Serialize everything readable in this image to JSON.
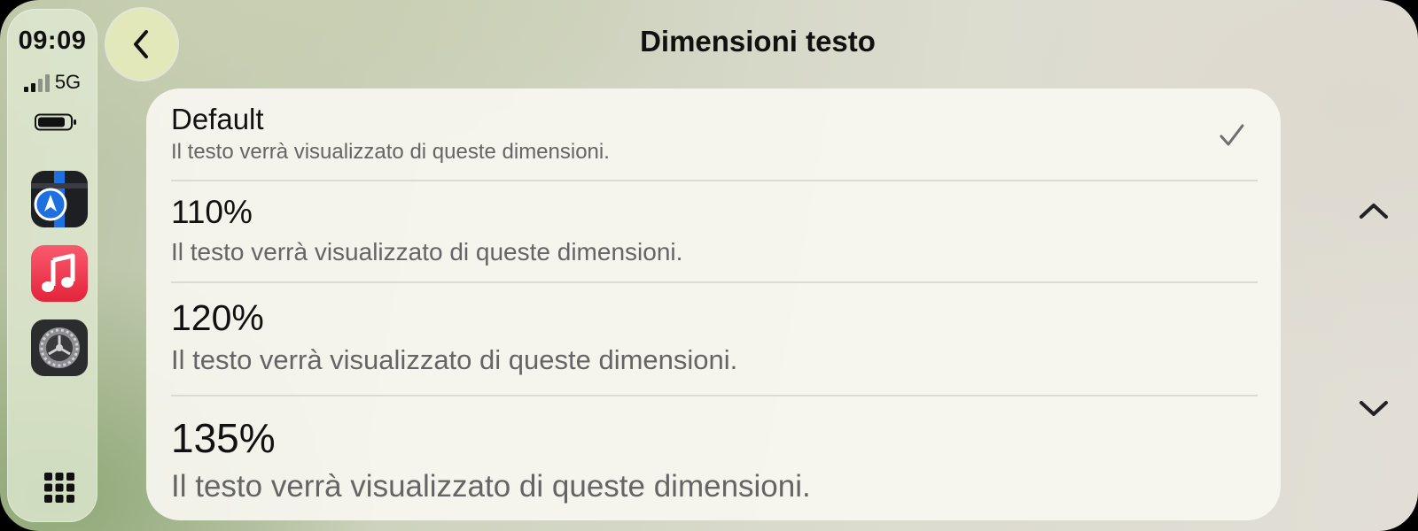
{
  "status": {
    "time": "09:09",
    "network": "5G"
  },
  "dock": {
    "apps": [
      {
        "icon": "maps-icon"
      },
      {
        "icon": "music-icon"
      },
      {
        "icon": "settings-icon"
      }
    ],
    "launcher_icon": "app-grid-icon"
  },
  "header": {
    "back_icon": "chevron-left-icon",
    "title": "Dimensioni testo"
  },
  "options": [
    {
      "label": "Default",
      "description": "Il testo verrà visualizzato di queste dimensioni.",
      "selected": true
    },
    {
      "label": "110%",
      "description": "Il testo verrà visualizzato di queste dimensioni.",
      "selected": false
    },
    {
      "label": "120%",
      "description": "Il testo verrà visualizzato di queste dimensioni.",
      "selected": false
    },
    {
      "label": "135%",
      "description": "Il testo verrà visualizzato di queste dimensioni.",
      "selected": false
    }
  ],
  "scroll": {
    "up_icon": "chevron-up-icon",
    "down_icon": "chevron-down-icon"
  },
  "colors": {
    "back_button": "#e3e8bb",
    "card": "#f7f6f0",
    "description_text": "#656565",
    "music_red": "#e3243a",
    "maps_blue": "#1e6fe0"
  }
}
